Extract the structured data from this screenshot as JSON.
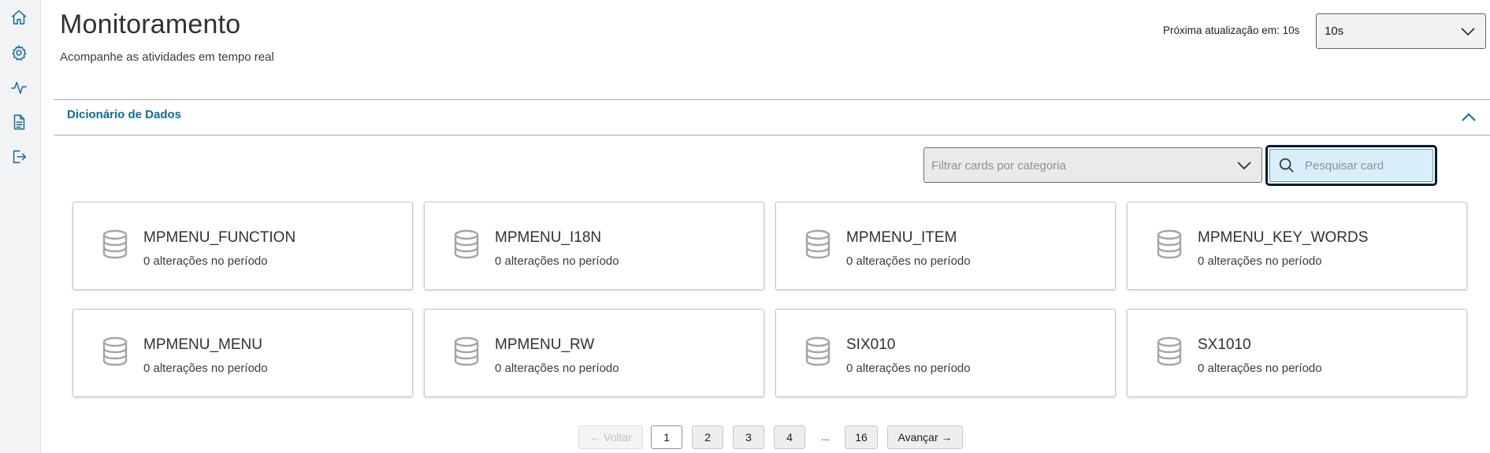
{
  "sidebar": {
    "items": [
      {
        "icon": "home-icon"
      },
      {
        "icon": "gear-icon"
      },
      {
        "icon": "activity-icon"
      },
      {
        "icon": "document-icon"
      },
      {
        "icon": "logout-icon"
      }
    ]
  },
  "header": {
    "title": "Monitoramento",
    "subtitle": "Acompanhe as atividades em tempo real",
    "refresh_label": "Próxima atualização em: 10s",
    "refresh_value": "10s"
  },
  "section": {
    "title": "Dicionário de Dados"
  },
  "filters": {
    "category_placeholder": "Filtrar cards por categoria",
    "search_placeholder": "Pesquisar card"
  },
  "cards": [
    {
      "name": "MPMENU_FUNCTION",
      "changes": "0 alterações no período"
    },
    {
      "name": "MPMENU_I18N",
      "changes": "0 alterações no período"
    },
    {
      "name": "MPMENU_ITEM",
      "changes": "0 alterações no período"
    },
    {
      "name": "MPMENU_KEY_WORDS",
      "changes": "0 alterações no período"
    },
    {
      "name": "MPMENU_MENU",
      "changes": "0 alterações no período"
    },
    {
      "name": "MPMENU_RW",
      "changes": "0 alterações no período"
    },
    {
      "name": "SIX010",
      "changes": "0 alterações no período"
    },
    {
      "name": "SX1010",
      "changes": "0 alterações no período"
    }
  ],
  "pagination": {
    "prev_label": "← Voltar",
    "pages": [
      "1",
      "2",
      "3",
      "4"
    ],
    "ellipsis": "...",
    "last_page": "16",
    "next_label": "Avançar →",
    "current_page": 1
  },
  "colors": {
    "accent": "#0c6c94",
    "search_bg": "#d8eef9",
    "focus_ring": "#0b1a2e"
  }
}
